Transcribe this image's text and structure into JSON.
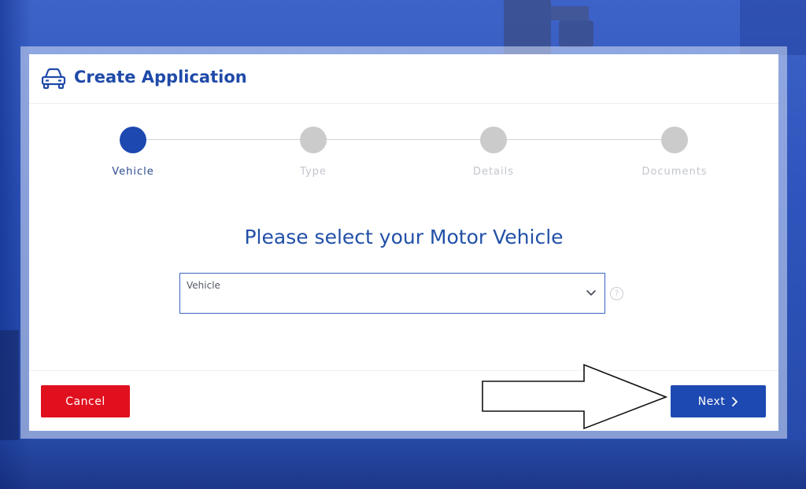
{
  "header": {
    "title": "Create Application",
    "icon": "car-icon"
  },
  "stepper": {
    "steps": [
      {
        "label": "Vehicle",
        "state": "active"
      },
      {
        "label": "Type",
        "state": "inactive"
      },
      {
        "label": "Details",
        "state": "inactive"
      },
      {
        "label": "Documents",
        "state": "inactive"
      }
    ]
  },
  "main": {
    "prompt": "Please select your Motor Vehicle",
    "vehicle_select": {
      "label": "Vehicle",
      "value": ""
    },
    "help_icon": "?"
  },
  "footer": {
    "cancel_label": "Cancel",
    "next_label": "Next"
  },
  "colors": {
    "primary": "#1d49b2",
    "danger": "#e0101e",
    "title": "#1f4aa8",
    "inactive_step": "#cbcbcb"
  }
}
